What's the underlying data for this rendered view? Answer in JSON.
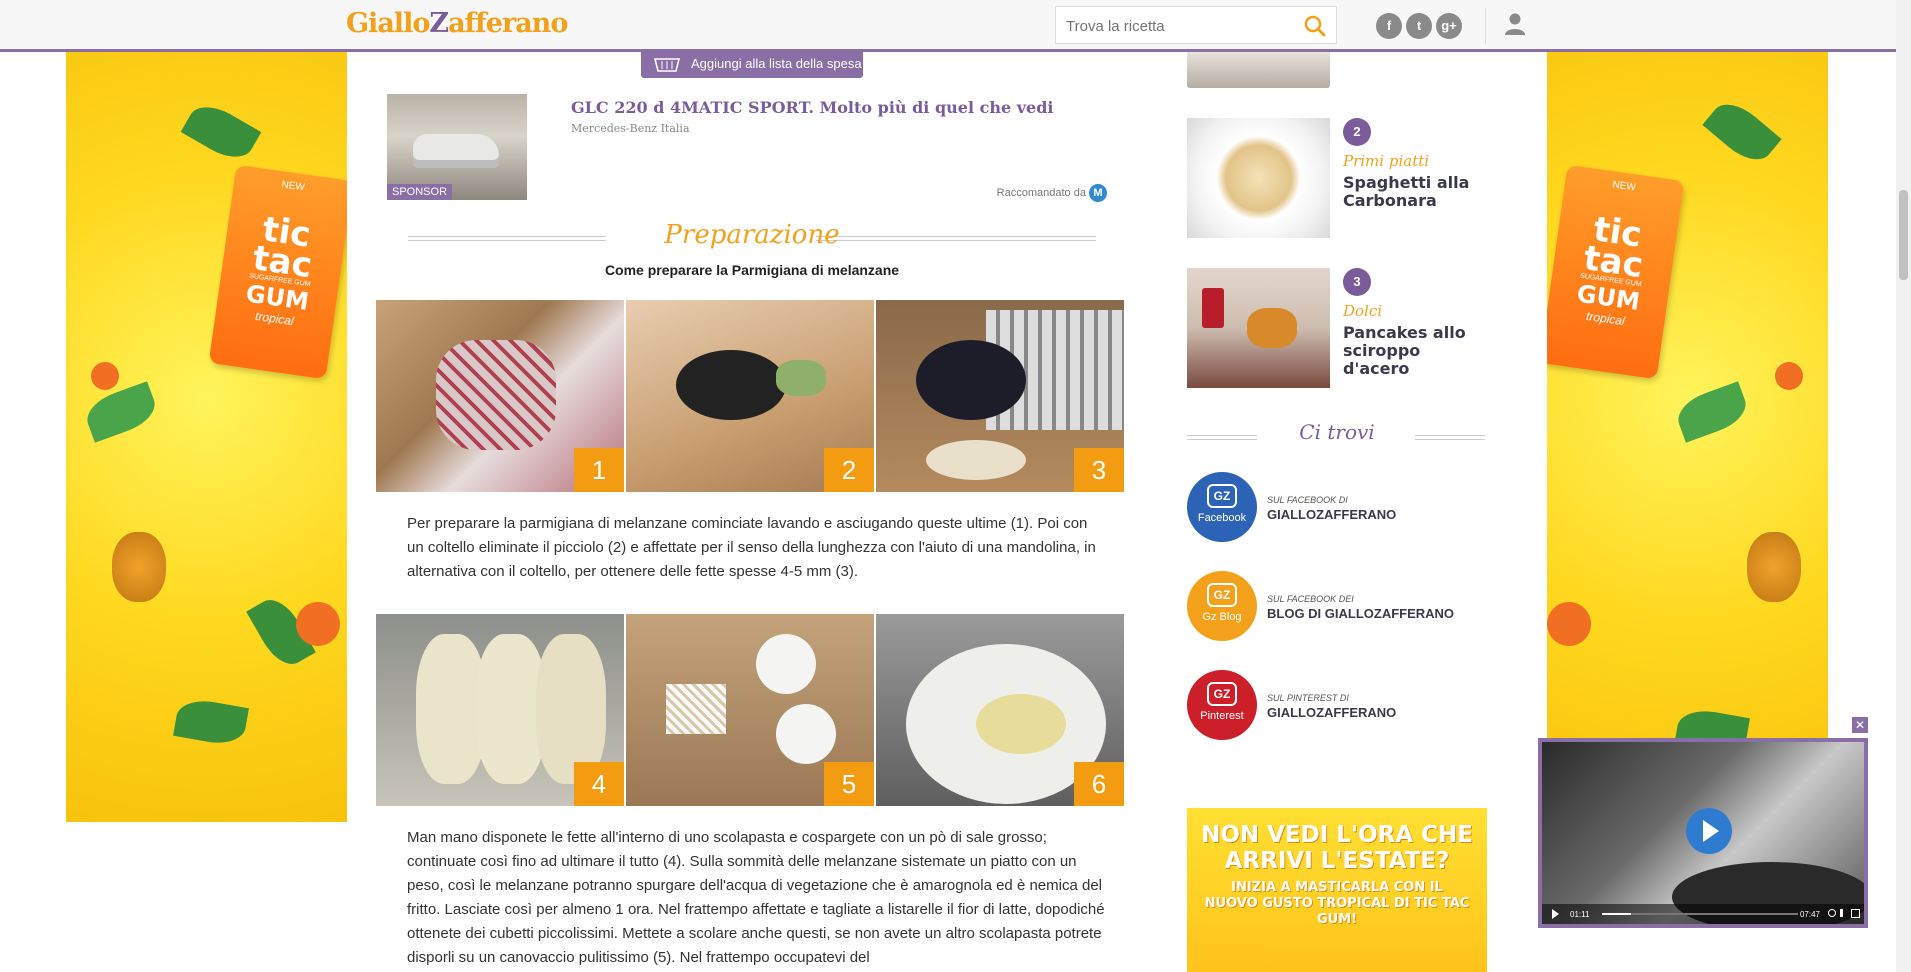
{
  "header": {
    "logo_text_1": "Giallo",
    "logo_text_2": "Z",
    "logo_text_3": "afferano",
    "search_placeholder": "Trova la ricetta",
    "social": [
      "f",
      "t",
      "g+"
    ]
  },
  "side_ad": {
    "badge": "NEW",
    "brand": "tic tac",
    "line": "SUGARFREE GUM",
    "product": "GUM",
    "flavor": "tropical"
  },
  "article": {
    "shopping_button": "Aggiungi alla lista della spesa",
    "sponsor": {
      "tag": "SPONSOR",
      "title": "GLC 220 d 4MATIC SPORT. Molto più di quel che vedi",
      "source": "Mercedes-Benz Italia",
      "recommended": "Raccomandato da"
    },
    "section_title": "Preparazione",
    "subtitle": "Come preparare la Parmigiana di melanzane",
    "steps_row1": [
      "1",
      "2",
      "3"
    ],
    "steps_row2": [
      "4",
      "5",
      "6"
    ],
    "paragraph1": "Per preparare la parmigiana di melanzane cominciate lavando e asciugando queste ultime (1). Poi con un coltello eliminate il picciolo (2) e affettate per il senso della lunghezza con l'aiuto di una mandolina, in alternativa con il coltello, per ottenere delle fette spesse 4-5 mm (3).",
    "paragraph2": "Man mano disponete le fette all'interno di uno scolapasta e cospargete con un pò di sale grosso; continuate così fino ad ultimare il tutto (4). Sulla sommità delle melanzane sistemate un piatto con un peso, così le melanzane potranno spurgare dell'acqua di vegetazione che è amarognola ed è nemica del fritto. Lasciate così per almeno 1 ora. Nel frattempo affettate e tagliate a listarelle il fior di latte, dopodiché ottenete dei cubetti piccolissimi. Mettete a scolare anche questi, se non avete un altro scolapasta potrete disporli su un canovaccio pulitissimo (5). Nel frattempo occupatevi del"
  },
  "sidebar": {
    "ranking": [
      {
        "rank": "2",
        "category": "Primi piatti",
        "title": "Spaghetti alla Carbonara"
      },
      {
        "rank": "3",
        "category": "Dolci",
        "title": "Pancakes allo sciroppo d'acero"
      }
    ],
    "ci_trovi": "Ci trovi",
    "follow": [
      {
        "circle_label": "Facebook",
        "small": "SUL FACEBOOK DI",
        "name": "GIALLOZAFFERANO",
        "color": "#2d63b6"
      },
      {
        "circle_label": "Gz Blog",
        "small": "SUL FACEBOOK DEI",
        "name": "BLOG DI GIALLOZAFFERANO",
        "color": "#f3a11b"
      },
      {
        "circle_label": "Pinterest",
        "small": "SUL PINTEREST DI",
        "name": "GIALLOZAFFERANO",
        "color": "#cc1f2a"
      }
    ],
    "ad_big": "NON VEDI L'ORA CHE ARRIVI L'ESTATE?",
    "ad_small": "INIZIA A MASTICARLA CON IL NUOVO GUSTO TROPICAL DI TIC TAC GUM!"
  },
  "video": {
    "close": "✕",
    "time_current": "01:11",
    "time_total": "07:47",
    "progress": 0.15
  }
}
